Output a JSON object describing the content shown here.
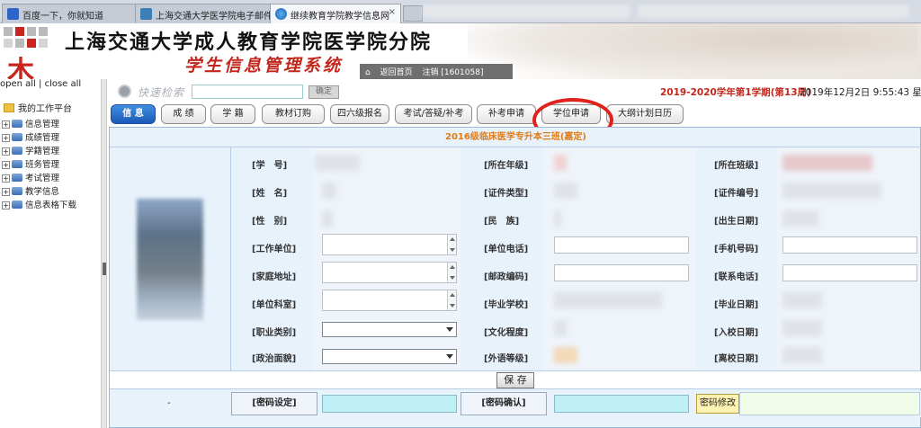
{
  "browser": {
    "tabs": [
      {
        "label": "百度一下，你就知道",
        "active": false
      },
      {
        "label": "上海交通大学医学院电子邮件...",
        "active": false
      },
      {
        "label": "继续教育学院教学信息网",
        "active": true
      }
    ],
    "close_glyph": "×"
  },
  "banner": {
    "school": "上海交通大学成人教育学院医学院分院",
    "system": "学生信息管理系统",
    "logo_glyph": "木",
    "links": [
      "返回首页",
      "注销 [1601058]"
    ]
  },
  "sidebar": {
    "open_all": "open all",
    "separator": "|",
    "close_all": "close all",
    "root": "我的工作平台",
    "items": [
      "信息管理",
      "成绩管理",
      "学籍管理",
      "班务管理",
      "考试管理",
      "教学信息",
      "信息表格下载"
    ]
  },
  "search": {
    "label": "快速检索",
    "value": "",
    "confirm": "确定"
  },
  "status": {
    "term": "2019-2020学年第1学期(第13周)",
    "datetime": "2019年12月2日 9:55:43 星期一"
  },
  "tabs": [
    {
      "label": "信 息",
      "active": true
    },
    {
      "label": "成 绩",
      "active": false
    },
    {
      "label": "学 籍",
      "active": false
    },
    {
      "label": "教材订购",
      "active": false
    },
    {
      "label": "四六级报名",
      "active": false
    },
    {
      "label": "考试/答疑/补考",
      "active": false
    },
    {
      "label": "补考申请",
      "active": false
    },
    {
      "label": "学位申请",
      "active": false
    },
    {
      "label": "大纲计划日历",
      "active": false
    }
  ],
  "form": {
    "class_title": "2016级临床医学专升本三班(嘉定)",
    "col1_labels": [
      "[学　号]",
      "[姓　名]",
      "[性　别]",
      "[工作单位]",
      "[家庭地址]",
      "[单位科室]",
      "[职业类别]",
      "[政治面貌]"
    ],
    "col2_labels": [
      "[所在年级]",
      "[证件类型]",
      "[民　族]",
      "[单位电话]",
      "[邮政编码]",
      "[毕业学校]",
      "[文化程度]",
      "[外语等级]"
    ],
    "col3_labels": [
      "[所在班级]",
      "[证件编号]",
      "[出生日期]",
      "[手机号码]",
      "[联系电话]",
      "[毕业日期]",
      "[入校日期]",
      "[离校日期]"
    ],
    "save": "保 存",
    "password_row": {
      "dash": "-",
      "set_label": "[密码设定]",
      "confirm_label": "[密码确认]",
      "modify_button": "密码修改"
    }
  },
  "colors": {
    "accent_red": "#c2261c",
    "active_tab": "#1d5ab8",
    "panel_bg": "#e8f2fb",
    "highlight": "#e0221c"
  }
}
